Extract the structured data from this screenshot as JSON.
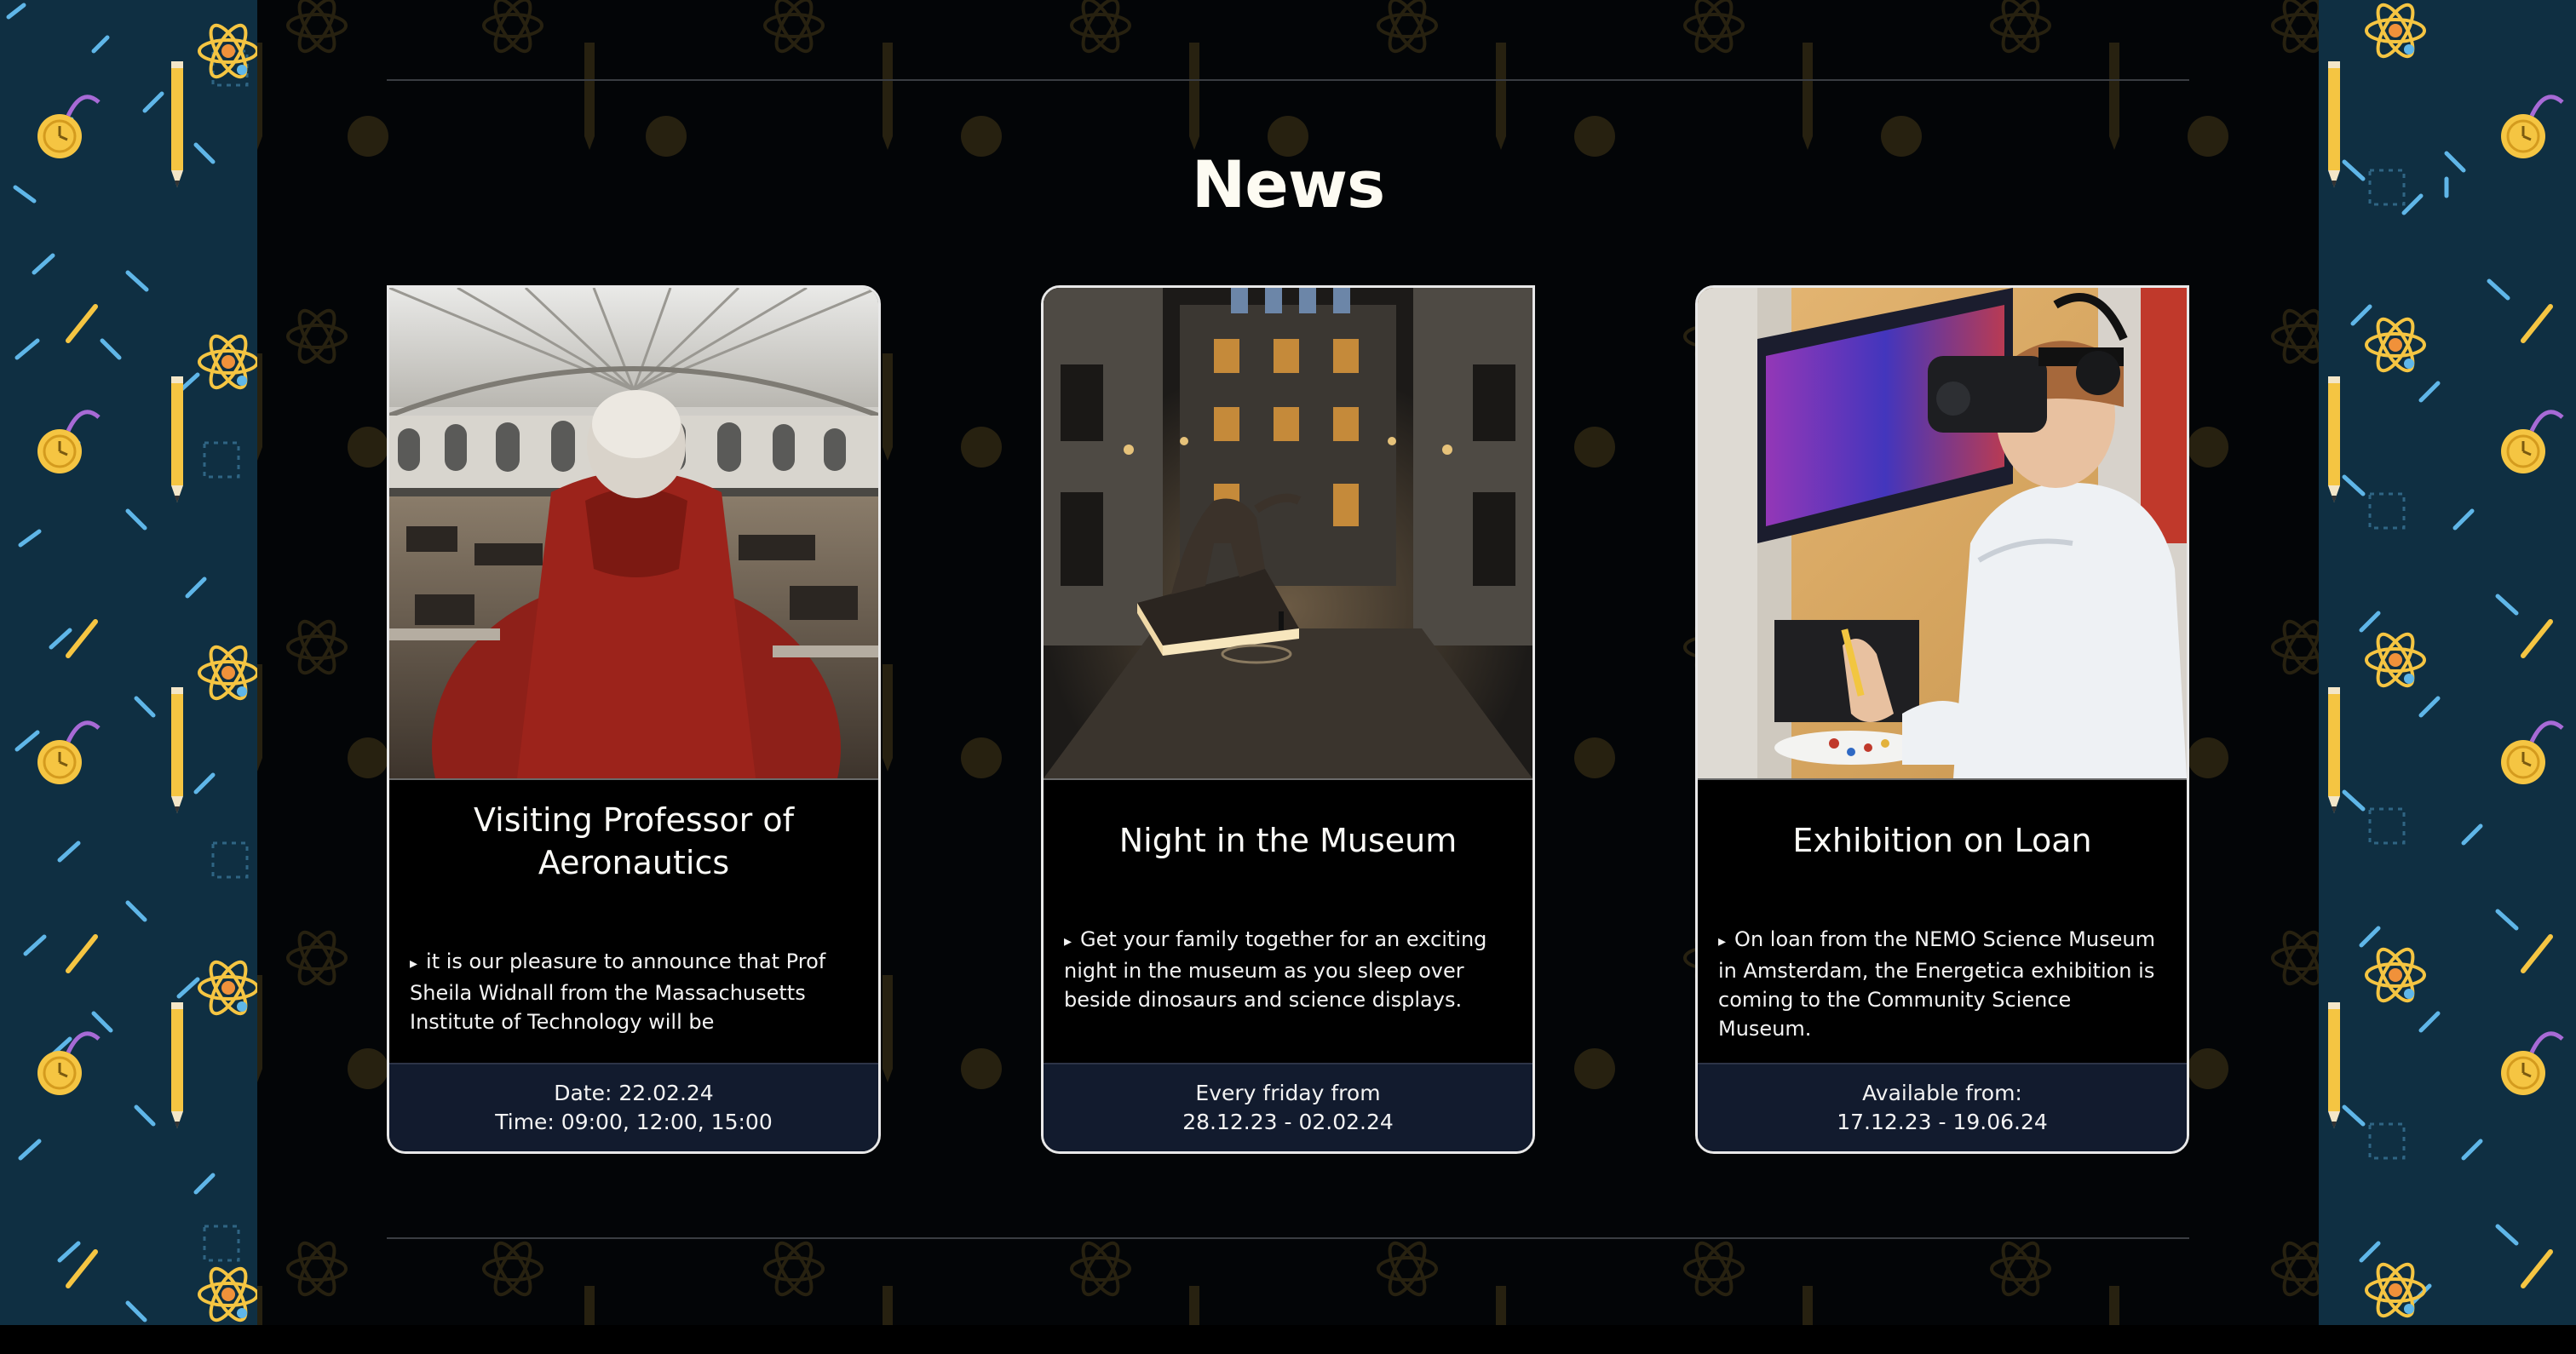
{
  "section": {
    "title": "News"
  },
  "cards": [
    {
      "title": "Visiting Professor of Aeronautics",
      "body": "it is our pleasure to announce that Prof Sheila Widnall from the Massachusetts Institute of Technology will be",
      "footer_line1": "Date: 22.02.24",
      "footer_line2": "Time: 09:00, 12:00, 15:00"
    },
    {
      "title": "Night in the Museum",
      "body": "Get your family together for an exciting night in the museum as you sleep over beside dinosaurs and science displays.",
      "footer_line1": "Every friday from",
      "footer_line2": "28.12.23 - 02.02.24"
    },
    {
      "title": "Exhibition on Loan",
      "body": "On loan from the NEMO Science Museum in Amsterdam, the Energetica exhibition is coming to the Community Science Museum.",
      "footer_line1": "Available from:",
      "footer_line2": "17.12.23 - 19.06.24"
    }
  ],
  "icons": {
    "bullet": "▸",
    "pattern": [
      "atom-icon",
      "pencil-icon",
      "stopwatch-icon",
      "dash-confetti"
    ]
  },
  "colors": {
    "side_panel": "#0f2f42",
    "accent_yellow": "#f5c542",
    "accent_orange": "#f0913a",
    "accent_blue": "#5fb6e8",
    "footer_bg": "#121b2e"
  },
  "bullet": "▸"
}
